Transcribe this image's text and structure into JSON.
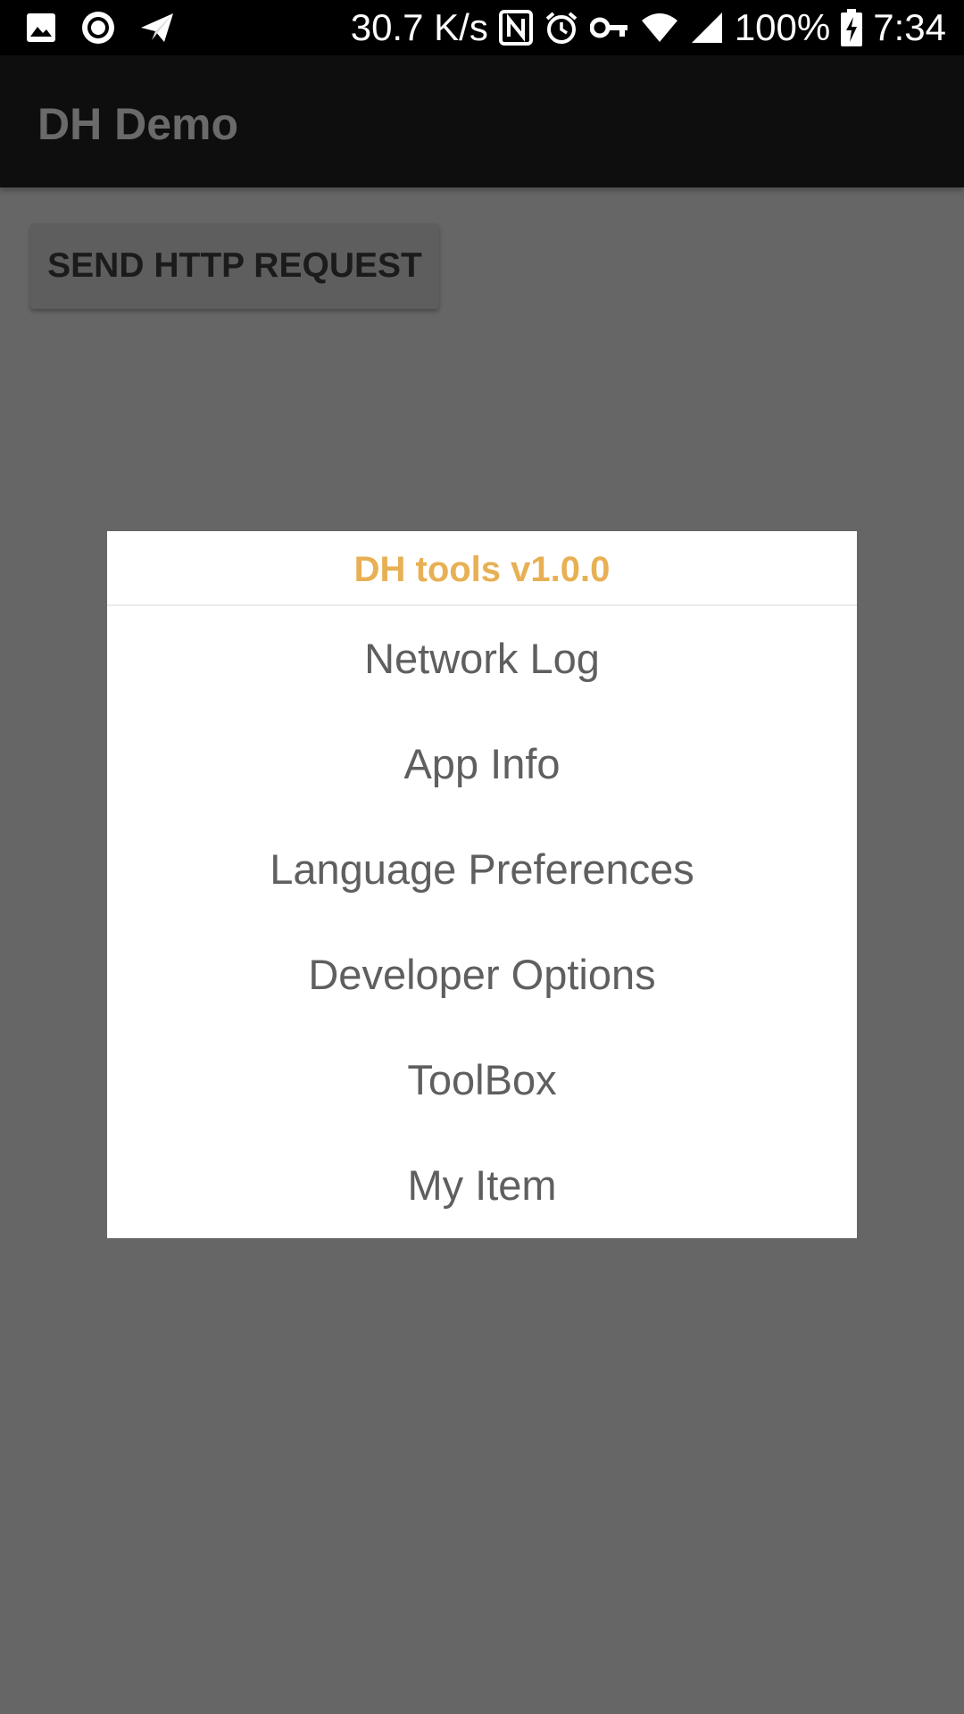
{
  "status_bar": {
    "network_speed": "30.7 K/s",
    "battery_percent": "100%",
    "time": "7:34",
    "left_icons": [
      "image-icon",
      "record-icon",
      "send-icon"
    ],
    "right_icons": [
      "nfc-icon",
      "alarm-icon",
      "vpn-key-icon",
      "wifi-icon",
      "cellular-signal-icon",
      "battery-charging-icon"
    ]
  },
  "app_bar": {
    "title": "DH Demo"
  },
  "main": {
    "send_button_label": "SEND HTTP REQUEST"
  },
  "dialog": {
    "title": "DH tools v1.0.0",
    "title_color": "#e8b054",
    "items": [
      {
        "label": "Network Log"
      },
      {
        "label": "App Info"
      },
      {
        "label": "Language Preferences"
      },
      {
        "label": "Developer Options"
      },
      {
        "label": "ToolBox"
      },
      {
        "label": "My Item"
      }
    ]
  },
  "colors": {
    "scrim_background": "#666666",
    "app_bar_dimmed": "#0e0e0e",
    "status_bar": "#000000"
  }
}
